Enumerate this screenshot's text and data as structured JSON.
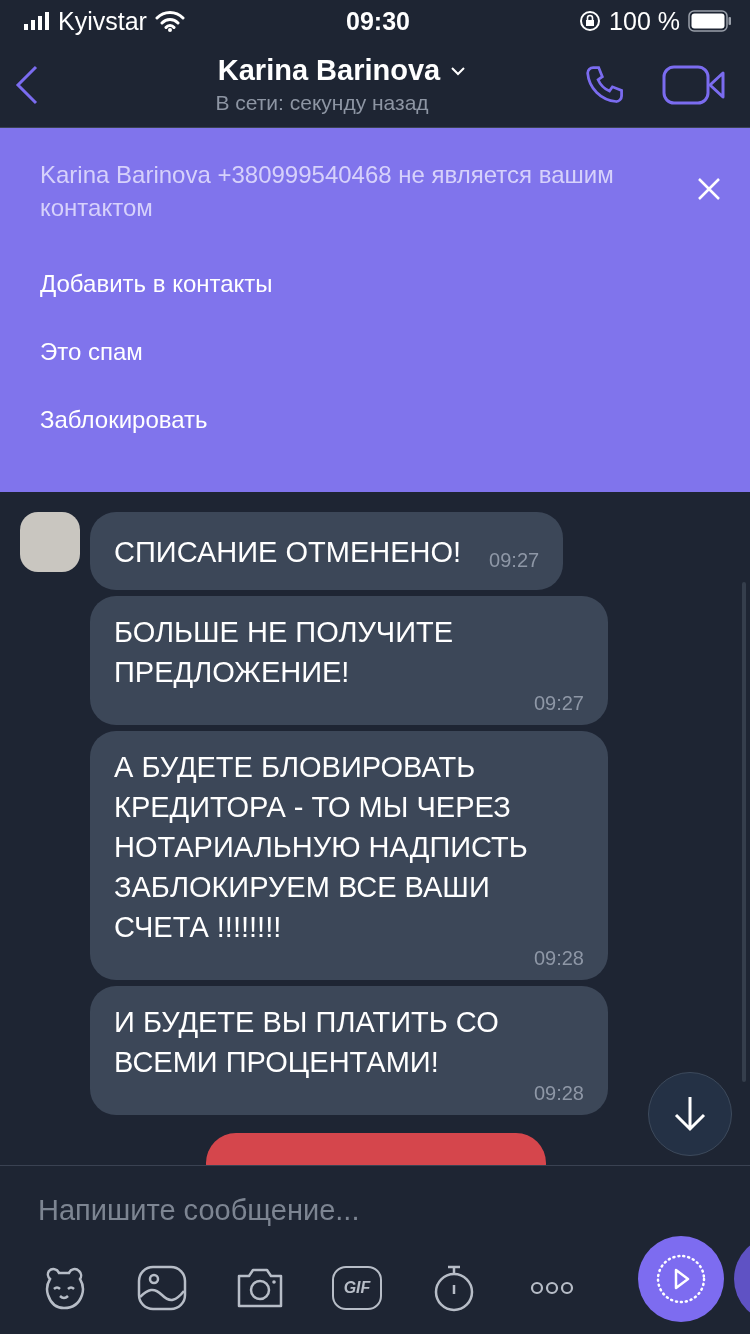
{
  "status_bar": {
    "carrier": "Kyivstar",
    "time": "09:30",
    "battery": "100 %"
  },
  "header": {
    "title": "Karina Barinova",
    "subtitle": "В сети: секунду назад"
  },
  "banner": {
    "notice": "Karina Barinova +380999540468 не является вашим контактом",
    "actions": [
      "Добавить в контакты",
      "Это спам",
      "Заблокировать"
    ]
  },
  "messages": [
    {
      "text": "СПИСАНИЕ ОТМЕНЕНО!",
      "time": "09:27",
      "avatar": true
    },
    {
      "text": "БОЛЬШЕ НЕ ПОЛУЧИТЕ ПРЕДЛОЖЕНИЕ!",
      "time": "09:27",
      "avatar": false
    },
    {
      "text": "А БУДЕТЕ БЛОВИРОВАТЬ КРЕДИТОРА - ТО МЫ ЧЕРЕЗ НОТАРИАЛЬНУЮ НАДПИСТЬ ЗАБЛОКИРУЕМ ВСЕ ВАШИ СЧЕТА !!!!!!!!",
      "time": "09:28",
      "avatar": false
    },
    {
      "text": "И БУДЕТЕ ВЫ ПЛАТИТЬ СО ВСЕМИ ПРОЦЕНТАМИ!",
      "time": "09:28",
      "avatar": false
    }
  ],
  "composer": {
    "placeholder": "Напишите сообщение...",
    "gif_label": "GIF"
  }
}
